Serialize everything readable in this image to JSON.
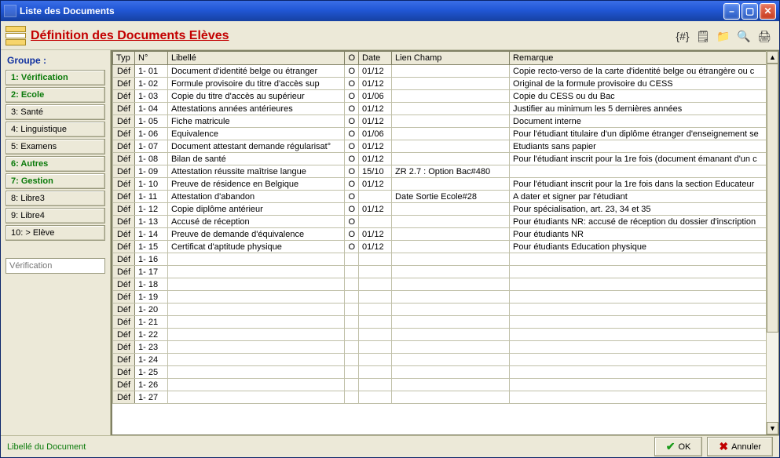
{
  "window": {
    "title": "Liste des Documents",
    "header_title": "Définition des Documents Elèves"
  },
  "toolbar": {
    "icons": [
      "number-format-icon",
      "note-icon",
      "folder-icon",
      "search-icon",
      "print-icon"
    ]
  },
  "sidebar": {
    "group_label": "Groupe :",
    "items": [
      {
        "label": "1: Vérification",
        "highlight": true
      },
      {
        "label": "2: Ecole",
        "highlight": true
      },
      {
        "label": "3: Santé",
        "highlight": false
      },
      {
        "label": "4: Linguistique",
        "highlight": false
      },
      {
        "label": "5: Examens",
        "highlight": false
      },
      {
        "label": "6: Autres",
        "highlight": true
      },
      {
        "label": "7: Gestion",
        "highlight": true
      },
      {
        "label": "8: Libre3",
        "highlight": false
      },
      {
        "label": "9: Libre4",
        "highlight": false
      },
      {
        "label": "10: > Elève",
        "highlight": false
      }
    ],
    "input_placeholder": "Vérification"
  },
  "grid": {
    "columns": [
      "Typ",
      "N°",
      "Libellé",
      "O",
      "Date",
      "Lien Champ",
      "Remarque"
    ],
    "rows": [
      {
        "typ": "Déf",
        "num": "1- 01",
        "lib": "Document d'identité belge ou étranger",
        "o": "O",
        "date": "01/12",
        "lien": "",
        "rem": "Copie recto-verso de la carte d'identité belge ou étrangère ou c"
      },
      {
        "typ": "Déf",
        "num": "1- 02",
        "lib": "Formule provisoire du titre d'accès sup",
        "o": "O",
        "date": "01/12",
        "lien": "",
        "rem": "Original de la formule provisoire du CESS"
      },
      {
        "typ": "Déf",
        "num": "1- 03",
        "lib": "Copie du titre d'accès au supérieur",
        "o": "O",
        "date": "01/06",
        "lien": "",
        "rem": "Copie du CESS ou du Bac"
      },
      {
        "typ": "Déf",
        "num": "1- 04",
        "lib": "Attestations années antérieures",
        "o": "O",
        "date": "01/12",
        "lien": "",
        "rem": "Justifier au minimum les 5 dernières années"
      },
      {
        "typ": "Déf",
        "num": "1- 05",
        "lib": "Fiche matricule",
        "o": "O",
        "date": "01/12",
        "lien": "",
        "rem": "Document interne"
      },
      {
        "typ": "Déf",
        "num": "1- 06",
        "lib": "Equivalence",
        "o": "O",
        "date": "01/06",
        "lien": "",
        "rem": "Pour l'étudiant titulaire d'un diplôme étranger d'enseignement se"
      },
      {
        "typ": "Déf",
        "num": "1- 07",
        "lib": "Document attestant demande régularisat°",
        "o": "O",
        "date": "01/12",
        "lien": "",
        "rem": "Etudiants sans papier"
      },
      {
        "typ": "Déf",
        "num": "1- 08",
        "lib": "Bilan de santé",
        "o": "O",
        "date": "01/12",
        "lien": "",
        "rem": "Pour l'étudiant inscrit pour la 1re fois (document émanant d'un c"
      },
      {
        "typ": "Déf",
        "num": "1- 09",
        "lib": "Attestation réussite maîtrise langue",
        "o": "O",
        "date": "15/10",
        "lien": "ZR 2.7 : Option Bac#480",
        "rem": ""
      },
      {
        "typ": "Déf",
        "num": "1- 10",
        "lib": "Preuve de résidence en Belgique",
        "o": "O",
        "date": "01/12",
        "lien": "",
        "rem": "Pour l'étudiant inscrit pour la 1re fois dans la section Educateur"
      },
      {
        "typ": "Déf",
        "num": "1- 11",
        "lib": "Attestation d'abandon",
        "o": "O",
        "date": "",
        "lien": "Date Sortie Ecole#28",
        "rem": "A dater et signer par l'étudiant"
      },
      {
        "typ": "Déf",
        "num": "1- 12",
        "lib": "Copie diplôme antérieur",
        "o": "O",
        "date": "01/12",
        "lien": "",
        "rem": "Pour spécialisation, art. 23, 34 et 35"
      },
      {
        "typ": "Déf",
        "num": "1- 13",
        "lib": "Accusé de réception",
        "o": "O",
        "date": "",
        "lien": "",
        "rem": "Pour étudiants NR: accusé de réception du dossier d'inscription"
      },
      {
        "typ": "Déf",
        "num": "1- 14",
        "lib": "Preuve de demande d'équivalence",
        "o": "O",
        "date": "01/12",
        "lien": "",
        "rem": "Pour étudiants NR"
      },
      {
        "typ": "Déf",
        "num": "1- 15",
        "lib": "Certificat d'aptitude physique",
        "o": "O",
        "date": "01/12",
        "lien": "",
        "rem": "Pour étudiants Education physique"
      },
      {
        "typ": "Déf",
        "num": "1- 16",
        "lib": "",
        "o": "",
        "date": "",
        "lien": "",
        "rem": ""
      },
      {
        "typ": "Déf",
        "num": "1- 17",
        "lib": "",
        "o": "",
        "date": "",
        "lien": "",
        "rem": ""
      },
      {
        "typ": "Déf",
        "num": "1- 18",
        "lib": "",
        "o": "",
        "date": "",
        "lien": "",
        "rem": ""
      },
      {
        "typ": "Déf",
        "num": "1- 19",
        "lib": "",
        "o": "",
        "date": "",
        "lien": "",
        "rem": ""
      },
      {
        "typ": "Déf",
        "num": "1- 20",
        "lib": "",
        "o": "",
        "date": "",
        "lien": "",
        "rem": ""
      },
      {
        "typ": "Déf",
        "num": "1- 21",
        "lib": "",
        "o": "",
        "date": "",
        "lien": "",
        "rem": ""
      },
      {
        "typ": "Déf",
        "num": "1- 22",
        "lib": "",
        "o": "",
        "date": "",
        "lien": "",
        "rem": ""
      },
      {
        "typ": "Déf",
        "num": "1- 23",
        "lib": "",
        "o": "",
        "date": "",
        "lien": "",
        "rem": ""
      },
      {
        "typ": "Déf",
        "num": "1- 24",
        "lib": "",
        "o": "",
        "date": "",
        "lien": "",
        "rem": ""
      },
      {
        "typ": "Déf",
        "num": "1- 25",
        "lib": "",
        "o": "",
        "date": "",
        "lien": "",
        "rem": ""
      },
      {
        "typ": "Déf",
        "num": "1- 26",
        "lib": "",
        "o": "",
        "date": "",
        "lien": "",
        "rem": ""
      },
      {
        "typ": "Déf",
        "num": "1- 27",
        "lib": "",
        "o": "",
        "date": "",
        "lien": "",
        "rem": ""
      }
    ]
  },
  "footer": {
    "status": "Libellé du Document",
    "ok_label": "OK",
    "cancel_label": "Annuler"
  }
}
